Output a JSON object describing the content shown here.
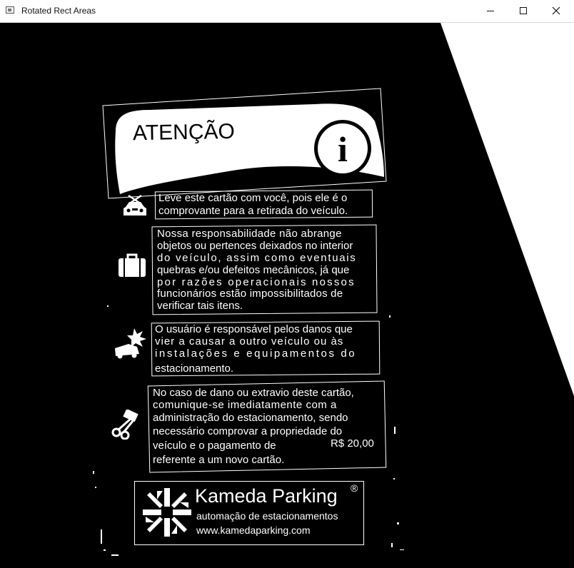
{
  "window": {
    "title": "Rotated Rect Areas"
  },
  "sign": {
    "heading": "ATENÇÃO",
    "info_letter": "i",
    "notices": [
      {
        "lines": [
          "Leve este cartão com você, pois ele é o",
          "comprovante para a retirada do veículo."
        ]
      },
      {
        "lines": [
          "Nossa responsabilidade não abrange",
          "objetos ou pertences deixados no interior",
          "do veículo, assim como eventuais",
          "quebras e/ou defeitos mecânicos, já que",
          "por razões operacionais nossos",
          "funcionários estão impossibilitados de",
          "verificar tais itens."
        ]
      },
      {
        "lines": [
          "O usuário é responsável pelos danos que",
          "vier a causar a outro veículo ou às",
          "instalações e equipamentos do",
          "estacionamento."
        ]
      },
      {
        "lines": [
          "No caso de dano ou extravio deste cartão,",
          "comunique-se imediatamente com a",
          "administração do estacionamento, sendo",
          "necessário comprovar a propriedade do",
          "veículo e o pagamento de",
          "referente a um novo cartão."
        ],
        "price": "R$ 20,00"
      }
    ],
    "brand": {
      "name": "Kameda Parking",
      "registered": "®",
      "tagline": "automação de estacionamentos",
      "url": "www.kamedaparking.com"
    }
  },
  "colors": {
    "background": "#000000",
    "foreground": "#ffffff"
  }
}
